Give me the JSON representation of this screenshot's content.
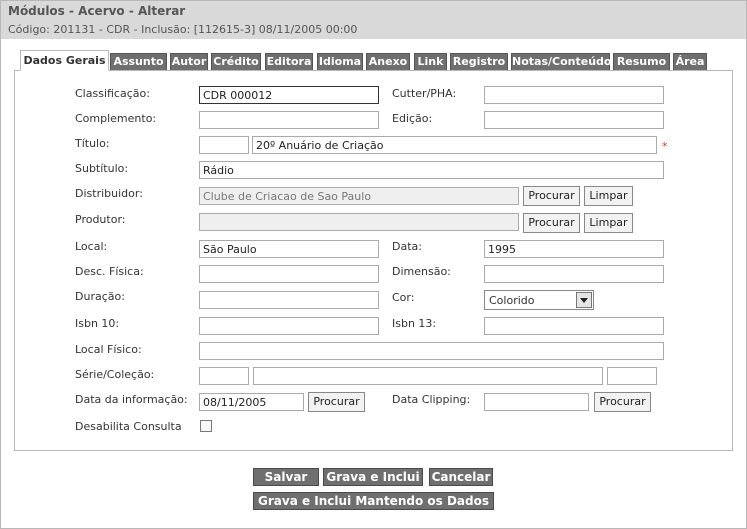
{
  "header": {
    "title": "Módulos - Acervo - Alterar",
    "subtitle": "Código: 201131 - CDR - Inclusão: [112615-3] 08/11/2005 00:00"
  },
  "tabs": [
    "Dados Gerais",
    "Assunto",
    "Autor",
    "Crédito",
    "Editora",
    "Idioma",
    "Anexo",
    "Link",
    "Registro",
    "Notas/Conteúdo",
    "Resumo",
    "Área"
  ],
  "form": {
    "classificacao": {
      "label": "Classificação:",
      "value": "CDR 000012"
    },
    "cutter": {
      "label": "Cutter/PHA:",
      "value": ""
    },
    "complemento": {
      "label": "Complemento:",
      "value": ""
    },
    "edicao": {
      "label": "Edição:",
      "value": ""
    },
    "titulo": {
      "label": "Título:",
      "prefix": "",
      "value": "20º Anuário de Criação",
      "required_mark": "*"
    },
    "subtitulo": {
      "label": "Subtítulo:",
      "value": "Rádio"
    },
    "distribuidor": {
      "label": "Distribuidor:",
      "value": "Clube de Criacao de Sao Paulo"
    },
    "produtor": {
      "label": "Produtor:",
      "value": ""
    },
    "local": {
      "label": "Local:",
      "value": "São Paulo"
    },
    "data": {
      "label": "Data:",
      "value": "1995"
    },
    "desc_fisica": {
      "label": "Desc. Física:",
      "value": ""
    },
    "dimensao": {
      "label": "Dimensão:",
      "value": ""
    },
    "duracao": {
      "label": "Duração:",
      "value": ""
    },
    "cor": {
      "label": "Cor:",
      "value": "Colorido"
    },
    "isbn10": {
      "label": "Isbn 10:",
      "value": ""
    },
    "isbn13": {
      "label": "Isbn 13:",
      "value": ""
    },
    "local_fisico": {
      "label": "Local Físico:",
      "value": ""
    },
    "serie": {
      "label": "Série/Coleção:",
      "v1": "",
      "v2": "",
      "v3": ""
    },
    "data_informacao": {
      "label": "Data da informação:",
      "value": "08/11/2005"
    },
    "data_clipping": {
      "label": "Data Clipping:",
      "value": ""
    },
    "desabilita": {
      "label": "Desabilita Consulta",
      "checked": false
    }
  },
  "buttons": {
    "procurar": "Procurar",
    "limpar": "Limpar",
    "salvar": "Salvar",
    "grava_inclui": "Grava e Inclui",
    "cancelar": "Cancelar",
    "grava_mantendo": "Grava e Inclui Mantendo os Dados"
  }
}
